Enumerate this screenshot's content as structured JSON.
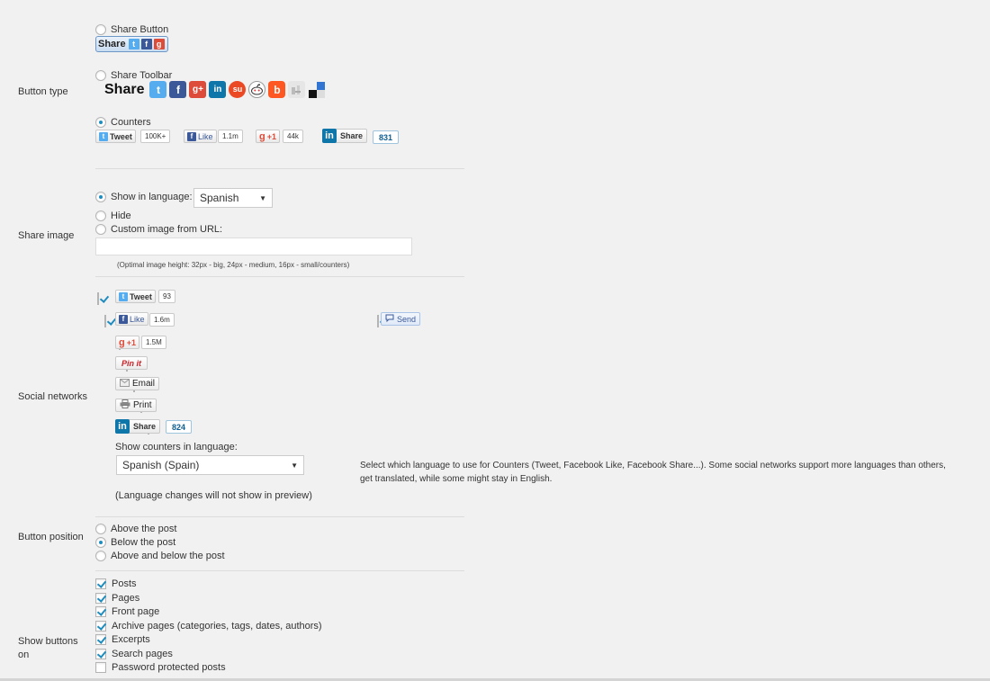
{
  "colors": {
    "page_bg": "#f1f1f1",
    "accent": "#1e8cbe",
    "twitter": "#55acee",
    "facebook": "#3b5998",
    "google": "#dd4b39",
    "linkedin": "#0e76a8",
    "pinterest": "#cb2027"
  },
  "button_type": {
    "label": "Button type",
    "share_button": {
      "label": "Share Button",
      "selected": false,
      "preview_word": "Share"
    },
    "share_toolbar": {
      "label": "Share Toolbar",
      "selected": false,
      "preview_word": "Share",
      "icons": [
        "twitter-icon",
        "facebook-icon",
        "google-plus-icon",
        "linkedin-icon",
        "stumbleupon-icon",
        "reddit-icon",
        "blogger-icon",
        "digg-icon",
        "delicious-icon"
      ]
    },
    "counters": {
      "label": "Counters",
      "selected": true,
      "tweet": {
        "label": "Tweet",
        "count": "100K+"
      },
      "like": {
        "label": "Like",
        "count": "1.1m"
      },
      "gplus": {
        "label": "+1",
        "count": "44k"
      },
      "linkedin": {
        "label": "Share",
        "count": "831"
      }
    }
  },
  "share_image": {
    "label": "Share image",
    "show_in_language": {
      "label": "Show in language:",
      "selected": true,
      "value": "Spanish"
    },
    "hide": {
      "label": "Hide",
      "selected": false
    },
    "custom_url": {
      "label": "Custom image from URL:",
      "selected": false,
      "value": ""
    },
    "note": "(Optimal image height: 32px - big, 24px - medium, 16px - small/counters)"
  },
  "social_networks": {
    "label": "Social networks",
    "items": [
      {
        "id": "twitter",
        "checked": true,
        "label": "Tweet",
        "count": "93"
      },
      {
        "id": "facebook",
        "checked": true,
        "label": "Like",
        "count": "1.6m"
      },
      {
        "id": "facebook-send",
        "checked": true,
        "label": "Send"
      },
      {
        "id": "google-plus",
        "checked": true,
        "label": "+1",
        "count": "1.5M"
      },
      {
        "id": "pinterest",
        "checked": false,
        "label": "Pin it"
      },
      {
        "id": "email",
        "checked": false,
        "label": "Email"
      },
      {
        "id": "print",
        "checked": false,
        "label": "Print"
      },
      {
        "id": "linkedin",
        "checked": false,
        "label": "Share",
        "count": "824"
      }
    ],
    "counters_language": {
      "label": "Show counters in language:",
      "value": "Spanish (Spain)",
      "note": "(Language changes will not show in preview)",
      "help_line1": "Select which language to use for Counters (Tweet, Facebook Like, Facebook Share...). Some social networks support more languages than others,",
      "help_line2": "get translated, while some might stay in English."
    }
  },
  "button_position": {
    "label": "Button position",
    "options": [
      {
        "label": "Above the post",
        "selected": false
      },
      {
        "label": "Below the post",
        "selected": true
      },
      {
        "label": "Above and below the post",
        "selected": false
      }
    ]
  },
  "show_buttons_on": {
    "label_line1": "Show buttons",
    "label_line2": "on",
    "options": [
      {
        "label": "Posts",
        "checked": true
      },
      {
        "label": "Pages",
        "checked": true
      },
      {
        "label": "Front page",
        "checked": true
      },
      {
        "label": "Archive pages (categories, tags, dates, authors)",
        "checked": true
      },
      {
        "label": "Excerpts",
        "checked": true
      },
      {
        "label": "Search pages",
        "checked": true
      },
      {
        "label": "Password protected posts",
        "checked": false
      }
    ]
  }
}
